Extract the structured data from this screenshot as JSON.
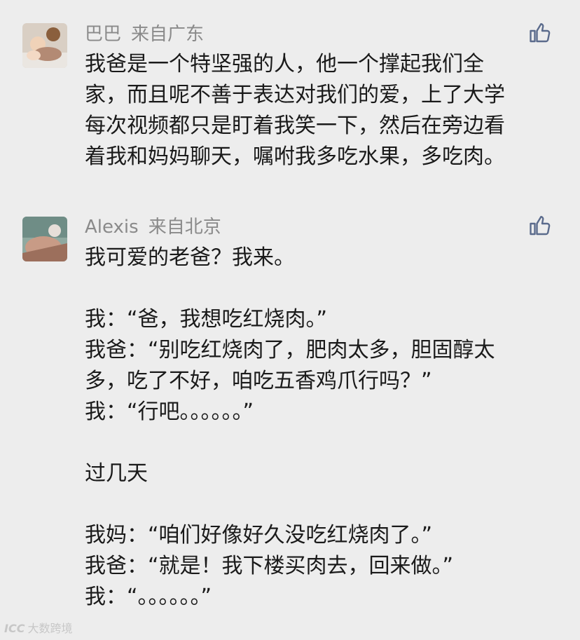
{
  "comments": [
    {
      "author": "巴巴",
      "origin": "来自广东",
      "lines": [
        "我爸是一个特坚强的人，他一个撑起我们全",
        "家，而且呢不善于表达对我们的爱，上了大学",
        "每次视频都只是盯着我笑一下，然后在旁边看",
        "着我和妈妈聊天，嘱咐我多吃水果，多吃肉。"
      ]
    },
    {
      "author": "Alexis",
      "origin": "来自北京",
      "lines": [
        "我可爱的老爸？我来。",
        "",
        "我：“爸，我想吃红烧肉。”",
        "我爸：“别吃红烧肉了，肥肉太多，胆固醇太",
        "多，吃了不好，咱吃五香鸡爪行吗？”",
        "我：“行吧。。。。。。”",
        "",
        "过几天",
        "",
        "我妈：“咱们好像好久没吃红烧肉了。”",
        "我爸：“就是！我下楼买肉去，回来做。”",
        "我：“。。。。。。”"
      ]
    }
  ],
  "icons": {
    "like": "thumbs-up-icon"
  },
  "colors": {
    "background": "#ededed",
    "meta_text": "#8a8a8a",
    "body_text": "#1a1a1a",
    "like_icon": "#5b6b8c"
  },
  "watermark": {
    "logo": "ICC",
    "text": "大数跨境"
  }
}
